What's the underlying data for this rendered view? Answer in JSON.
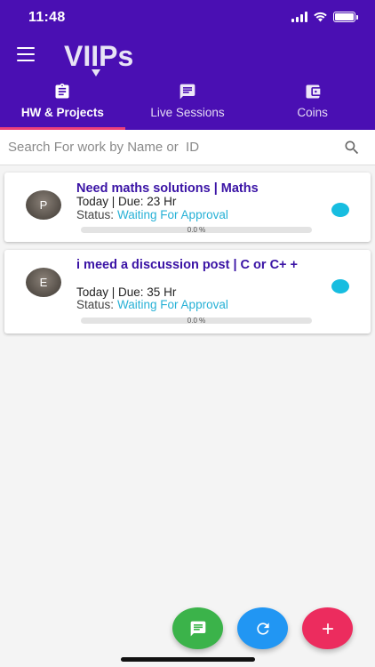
{
  "status_bar": {
    "time": "11:48"
  },
  "app": {
    "logo_text": "VIIPs"
  },
  "tabs": [
    {
      "label": "HW & Projects",
      "icon": "clipboard-icon",
      "active": true
    },
    {
      "label": "Live Sessions",
      "icon": "chat-icon",
      "active": false
    },
    {
      "label": "Coins",
      "icon": "wallet-icon",
      "active": false
    }
  ],
  "search": {
    "placeholder": "Search For work by Name or  ID",
    "value": ""
  },
  "tasks": [
    {
      "avatar": "P",
      "title": "Need maths solutions | Maths",
      "meta": "Today | Due: 23 Hr",
      "status_label": "Status:",
      "status_value": "Waiting For Approval",
      "progress_text": "0.0 %",
      "progress": 0.0
    },
    {
      "avatar": "E",
      "title": "i meed a discussion post | C or C+ +",
      "meta": "Today | Due: 35 Hr",
      "status_label": "Status:",
      "status_value": "Waiting For Approval",
      "progress_text": "0.0 %",
      "progress": 0.0
    }
  ],
  "colors": {
    "header": "#4a0fb3",
    "title": "#3a13a5",
    "status": "#27b1d6",
    "active_tab_indicator": "#ec407a",
    "fab_chat": "#3bb34a",
    "fab_refresh": "#2196f3",
    "fab_add": "#ec2c5e"
  },
  "fabs": [
    {
      "icon": "message-icon"
    },
    {
      "icon": "refresh-icon"
    },
    {
      "icon": "plus-icon"
    }
  ]
}
